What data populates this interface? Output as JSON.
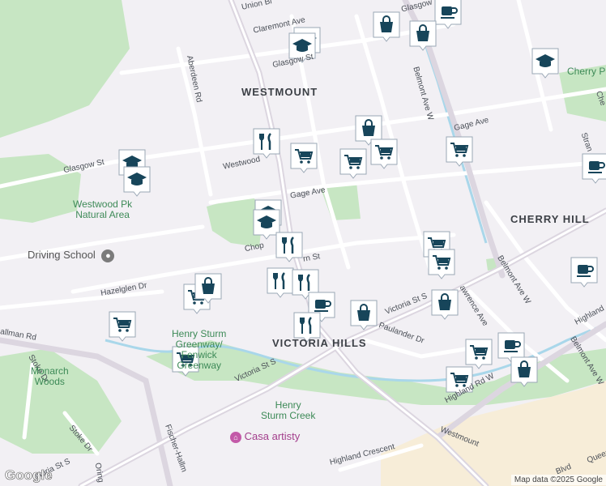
{
  "map": {
    "attribution": "Map data ©2025 Google",
    "logo_text": "Google",
    "colors": {
      "background": "#f2f0f4",
      "road": "#ffffff",
      "park": "#c7e6c3",
      "water": "#a9d7ea",
      "arterial": "#dcd6e0",
      "pin_bg": "#ffffff",
      "pin_fg": "#17455a"
    }
  },
  "areas": {
    "westmount": "WESTMOUNT",
    "cherry_hill": "CHERRY HILL",
    "victoria_hills": "VICTORIA HILLS"
  },
  "streets": {
    "union": "Union Bl",
    "claremont": "Claremont Ave",
    "glasgow_top": "Glasgow St",
    "glasgow_left": "Glasgow St",
    "glasgow_top_right": "Glasgow",
    "aberdeen": "Aberdeen Rd",
    "belmont_w": "Belmont Ave W",
    "belmont_w2": "Belmont Ave W",
    "belmont_w3": "Belmont Ave W",
    "gage1": "Gage Ave",
    "gage2": "Gage Ave",
    "westwood": "Westwood",
    "chopin": "Chop",
    "hazelglen": "Hazelglen Dr",
    "victoria_s": "Victoria St S",
    "victoria_s2": "Victoria St S",
    "victoria_s3": "ictoria St S",
    "lawrence": "awrence Ave",
    "paulander": "Paulander Dr",
    "highland": "Highland Rd W",
    "highland2": "Highland",
    "highland_cres": "Highland Crescent",
    "westmount_rd": "Westmount",
    "stoke1": "Stoke Dr",
    "stoke2": "Stoke Dr",
    "fischer": "Fischer-Hallm",
    "allman": "allman Rd",
    "orly": "Oring",
    "queen": "Blvd",
    "queen2": "Queen",
    "strange": "Stran",
    "che": "Che",
    "mn": "rn St"
  },
  "parks": {
    "cherry_pk": "Cherry Pk",
    "westwood_pk": "Westwood Pk\nNatural Area",
    "henry_sturm_greenway": "Henry Sturm\nGreenway/\nFenwick\nGreenway",
    "monarch_woods": "Monarch\nWoods",
    "henry_sturm_creek": "Henry\nSturm Creek"
  },
  "pois": {
    "driving_school": "Driving School",
    "casa_artisty": "Casa artisty"
  },
  "pins": [
    {
      "icon": "coffee-icon"
    },
    {
      "icon": "shopping-bag-icon"
    },
    {
      "icon": "shopping-bag-icon"
    },
    {
      "icon": "school-icon"
    },
    {
      "icon": "school-icon"
    },
    {
      "icon": "school-icon"
    },
    {
      "icon": "restaurant-icon"
    },
    {
      "icon": "shopping-cart-icon"
    },
    {
      "icon": "shopping-bag-icon"
    },
    {
      "icon": "shopping-cart-icon"
    },
    {
      "icon": "shopping-cart-icon"
    },
    {
      "icon": "shopping-cart-icon"
    },
    {
      "icon": "school-icon"
    },
    {
      "icon": "school-icon"
    },
    {
      "icon": "school-icon"
    },
    {
      "icon": "restaurant-icon"
    },
    {
      "icon": "restaurant-icon"
    },
    {
      "icon": "restaurant-icon"
    },
    {
      "icon": "coffee-icon"
    },
    {
      "icon": "restaurant-icon"
    },
    {
      "icon": "shopping-bag-icon"
    },
    {
      "icon": "shopping-cart-icon"
    },
    {
      "icon": "shopping-cart-icon"
    },
    {
      "icon": "shopping-cart-icon"
    },
    {
      "icon": "shopping-cart-icon"
    },
    {
      "icon": "shopping-bag-icon"
    },
    {
      "icon": "shopping-cart-icon"
    },
    {
      "icon": "coffee-icon"
    },
    {
      "icon": "shopping-bag-icon"
    },
    {
      "icon": "coffee-icon"
    },
    {
      "icon": "shopping-cart-icon"
    },
    {
      "icon": "shopping-bag-icon"
    },
    {
      "icon": "school-icon"
    },
    {
      "icon": "coffee-icon"
    },
    {
      "icon": "shopping-cart-icon"
    }
  ]
}
